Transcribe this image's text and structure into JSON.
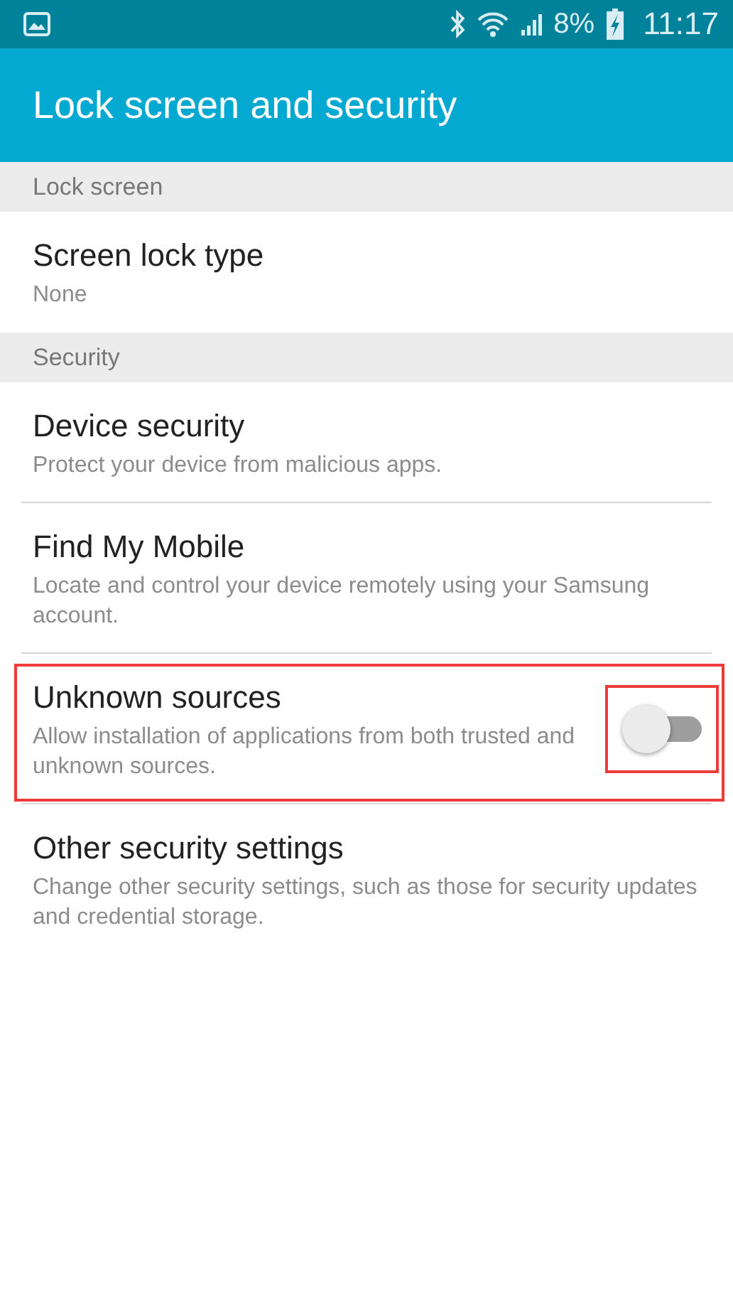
{
  "status_bar": {
    "battery_text": "8%",
    "time": "11:17"
  },
  "app_bar": {
    "title": "Lock screen and security"
  },
  "items": [
    {
      "kind": "section",
      "title": "Lock screen"
    },
    {
      "kind": "setting",
      "title": "Screen lock type",
      "summary": "None"
    },
    {
      "kind": "section",
      "title": "Security"
    },
    {
      "kind": "setting",
      "title": "Device security",
      "summary": "Protect your device from malicious apps."
    },
    {
      "kind": "setting",
      "title": "Find My Mobile",
      "summary": "Locate and control your device remotely using your Samsung account."
    },
    {
      "kind": "toggle",
      "title": "Unknown sources",
      "summary": "Allow installation of applications from both trusted and unknown sources.",
      "on": false,
      "highlighted": true,
      "switch_highlighted": true
    },
    {
      "kind": "setting",
      "title": "Other security settings",
      "summary": "Change other security settings, such as those for security updates and credential storage."
    }
  ]
}
